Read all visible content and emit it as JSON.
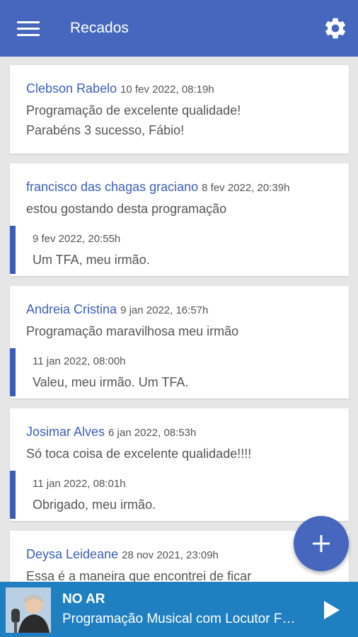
{
  "header": {
    "title": "Recados",
    "menu_icon": "hamburger-icon",
    "settings_icon": "gear-icon"
  },
  "messages": [
    {
      "author": "Clebson Rabelo",
      "time": "10 fev 2022, 08:19h",
      "lines": [
        "Programação de excelente qualidade!",
        "Parabéns 3 sucesso, Fábio!"
      ]
    },
    {
      "author": "francisco das chagas graciano",
      "time": "8 fev 2022, 20:39h",
      "lines": [
        "estou gostando desta programação"
      ],
      "reply": {
        "time": "9 fev 2022, 20:55h",
        "text": "Um TFA, meu irmão."
      }
    },
    {
      "author": "Andreia Cristina",
      "time": "9 jan 2022, 16:57h",
      "lines": [
        "Programação maravilhosa meu irmão"
      ],
      "reply": {
        "time": "11 jan 2022, 08:00h",
        "text": "Valeu, meu irmão. Um TFA."
      }
    },
    {
      "author": "Josimar Alves",
      "time": "6 jan 2022, 08:53h",
      "lines": [
        "Só toca coisa de excelente qualidade!!!!"
      ],
      "reply": {
        "time": "11 jan 2022, 08:01h",
        "text": "Obrigado, meu irmão."
      }
    },
    {
      "author": "Deysa Leideane",
      "time": "28 nov 2021, 23:09h",
      "lines": [
        "Essa é a maneira que encontrei de ficar"
      ]
    }
  ],
  "fab": {
    "icon": "plus-icon"
  },
  "player": {
    "status": "NO AR",
    "program": "Programação Musical com Locutor Fábio",
    "play_icon": "play-icon"
  },
  "colors": {
    "primary": "#4667bd",
    "player": "#1f7fc1",
    "author": "#3d5fb6",
    "reply_bar": "#3e5cb6"
  }
}
